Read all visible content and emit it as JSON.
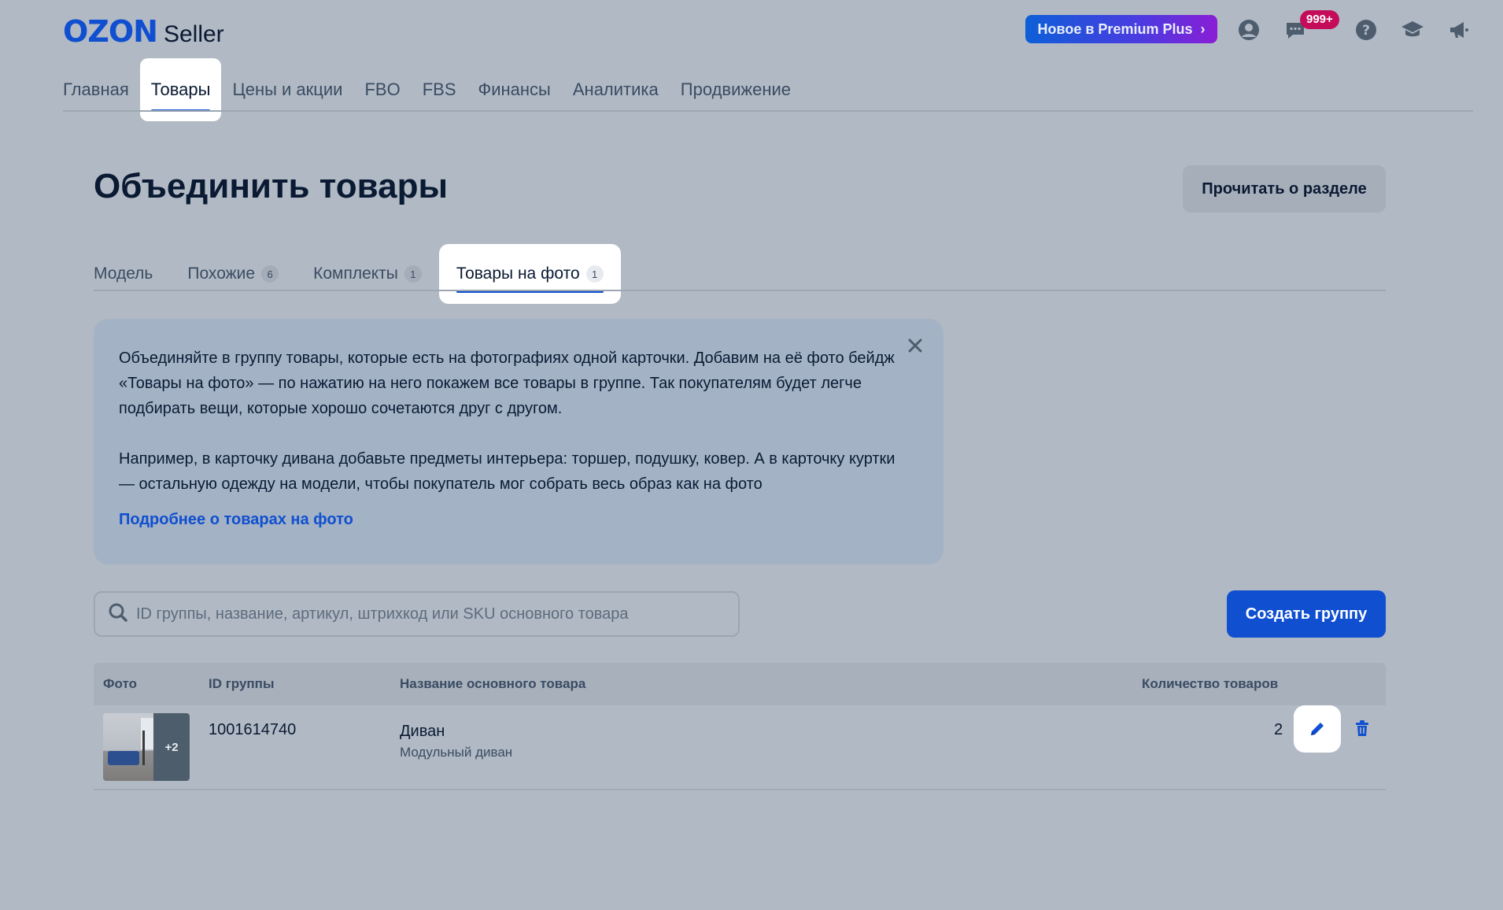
{
  "header": {
    "logo_main": "OZON",
    "logo_sub": "Seller",
    "premium_label": "Новое в Premium Plus",
    "messages_badge": "999+",
    "icons": [
      "profile-icon",
      "chat-icon",
      "help-icon",
      "education-icon",
      "announcement-icon"
    ]
  },
  "nav": {
    "items": [
      {
        "label": "Главная"
      },
      {
        "label": "Товары"
      },
      {
        "label": "Цены и акции"
      },
      {
        "label": "FBO"
      },
      {
        "label": "FBS"
      },
      {
        "label": "Финансы"
      },
      {
        "label": "Аналитика"
      },
      {
        "label": "Продвижение"
      }
    ],
    "active": "Товары"
  },
  "page": {
    "title": "Объединить товары",
    "read_button": "Прочитать о разделе"
  },
  "tabs": {
    "items": [
      {
        "label": "Модель",
        "count": ""
      },
      {
        "label": "Похожие",
        "count": "6"
      },
      {
        "label": "Комплекты",
        "count": "1"
      },
      {
        "label": "Товары на фото",
        "count": "1"
      }
    ],
    "active": "Товары на фото"
  },
  "banner": {
    "paragraph1": "Объединяйте в группу товары, которые есть на фотографиях одной карточки. Добавим на её фото бейдж «Товары на фото» — по нажатию на него покажем все товары в группе. Так покупателям будет легче подбирать вещи, которые хорошо сочетаются друг с другом.",
    "paragraph2": "Например, в карточку дивана добавьте предметы интерьера: торшер, подушку, ковер. А в карточку куртки — остальную одежду на модели, чтобы покупатель мог собрать весь образ как на фото",
    "link": "Подробнее о товарах на фото"
  },
  "search": {
    "placeholder": "ID группы, название, артикул, штрихкод или SKU основного товара",
    "value": ""
  },
  "create_button": "Создать группу",
  "table": {
    "columns": [
      "Фото",
      "ID группы",
      "Название основного товара",
      "Количество товаров"
    ],
    "rows": [
      {
        "photo_more": "+2",
        "group_id": "1001614740",
        "name": "Диван",
        "subtitle": "Модульный диван",
        "count": "2"
      }
    ]
  },
  "colors": {
    "accent": "#0f4fd0",
    "badge": "#c40c5a",
    "overlay_bg": "#b1bac4"
  }
}
